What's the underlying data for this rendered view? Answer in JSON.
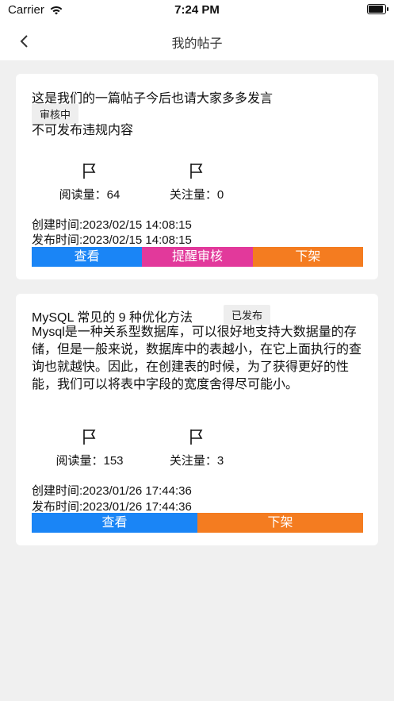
{
  "status_bar": {
    "carrier": "Carrier",
    "time": "7:24 PM"
  },
  "nav": {
    "title": "我的帖子"
  },
  "posts": [
    {
      "title": "这是我们的一篇帖子今后也请大家多多发言",
      "status": "审核中",
      "body": "不可发布违规内容",
      "reads_label": "阅读量：",
      "reads": "64",
      "follows_label": "关注量：",
      "follows": "0",
      "created": "创建时间:2023/02/15 14:08:15",
      "published": "发布时间:2023/02/15 14:08:15",
      "actions": [
        "查看",
        "提醒审核",
        "下架"
      ]
    },
    {
      "title": "MySQL 常见的 9 种优化方法",
      "status": "已发布",
      "body": "Mysql是一种关系型数据库，可以很好地支持大数据量的存储，但是一般来说，数据库中的表越小，在它上面执行的查询也就越快。因此，在创建表的时候，为了获得更好的性能，我们可以将表中字段的宽度舍得尽可能小。",
      "reads_label": "阅读量：",
      "reads": "153",
      "follows_label": "关注量：",
      "follows": "3",
      "created": "创建时间:2023/01/26 17:44:36",
      "published": "发布时间:2023/01/26 17:44:36",
      "actions": [
        "查看",
        "下架"
      ]
    }
  ],
  "colors": {
    "view": "#1a85f6",
    "remind": "#e2399b",
    "takedown": "#f47c20"
  },
  "icons": {
    "back": "chevron-left-icon",
    "stat": "flag-icon"
  }
}
